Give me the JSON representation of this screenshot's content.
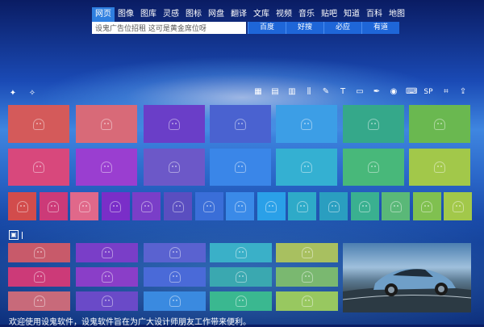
{
  "nav": {
    "tabs": [
      "网页",
      "图像",
      "图库",
      "灵感",
      "图标",
      "网盘",
      "翻译",
      "文库",
      "视频",
      "音乐",
      "贴吧",
      "知道",
      "百科",
      "地图"
    ],
    "active_index": 0
  },
  "search": {
    "value": "设鬼广告位招租 这可是黄金席位呀",
    "engines": [
      "百度",
      "好搜",
      "必应",
      "有道"
    ]
  },
  "toolbar": {
    "left_icons": [
      "compass-icon",
      "magic-wand-icon"
    ],
    "right_icons": [
      "calculator-icon",
      "document-icon",
      "notepad-icon",
      "equalizer-icon",
      "pencil-icon",
      "text-tool-icon",
      "note-icon",
      "eyedropper-icon",
      "color-wheel-icon",
      "keyboard-icon",
      "sp-icon",
      "crop-icon",
      "export-icon"
    ],
    "right_glyphs": [
      "▦",
      "▤",
      "▥",
      "⫼",
      "✎",
      "T",
      "▭",
      "✒",
      "◉",
      "⌨",
      "SP",
      "⌗",
      "⇪"
    ]
  },
  "tile_colors": {
    "row1": [
      "#d45a5a",
      "#d86a78",
      "#6a3ec8",
      "#4a62d0",
      "#3c9ee6",
      "#35a88a",
      "#6ab850"
    ],
    "row2": [
      "#d8487c",
      "#9a3ed0",
      "#6c58c8",
      "#3a86e8",
      "#34b0d2",
      "#48b87a",
      "#a2c84a"
    ],
    "row3": [
      "#d24c4c",
      "#cc3a78",
      "#e0688a",
      "#7a2ec8",
      "#7a3ec8",
      "#5a4ec0",
      "#3a6ed8",
      "#3a8ae8",
      "#2aa0e8",
      "#2eaac8",
      "#2a9ec0",
      "#3ab090",
      "#5ab878",
      "#80c050",
      "#a2c84a"
    ],
    "small_left": [
      [
        "#c85a6a",
        "#7a3ec8",
        "#5a62d0",
        "#3ab0c8",
        "#a8c060"
      ],
      [
        "#cc3a78",
        "#8a3ec8",
        "#4a6ad8",
        "#3aa8b0",
        "#7ab870"
      ],
      [
        "#c86a7a",
        "#6a4ac8",
        "#3a8ae0",
        "#3ab890",
        "#98c860"
      ]
    ]
  },
  "section2": {
    "marker": "▣"
  },
  "footer": {
    "text": "欢迎使用设鬼软件，设鬼软件旨在为广大设计师朋友工作带来便利。"
  }
}
